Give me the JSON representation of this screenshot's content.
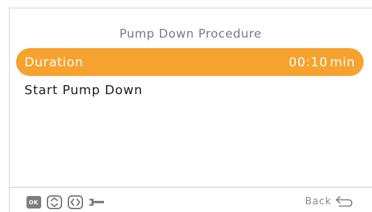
{
  "screen": {
    "title": "Pump Down Procedure"
  },
  "menu": {
    "items": [
      {
        "label": "Duration",
        "value": "00:10",
        "unit": "min",
        "selected": true
      },
      {
        "label": "Start Pump Down",
        "selected": false
      }
    ]
  },
  "footer": {
    "icons": [
      {
        "name": "ok-icon",
        "label": "OK"
      },
      {
        "name": "up-down-arrows-icon"
      },
      {
        "name": "left-right-arrows-icon"
      },
      {
        "name": "wrench-icon"
      }
    ],
    "back_label": "Back",
    "back_icon": "back-arrow-icon"
  },
  "colors": {
    "accent": "#f6a22e",
    "title_text": "#7a7a7a",
    "body_text": "#1e1e1e",
    "icon_gray": "#7d7d7d"
  }
}
